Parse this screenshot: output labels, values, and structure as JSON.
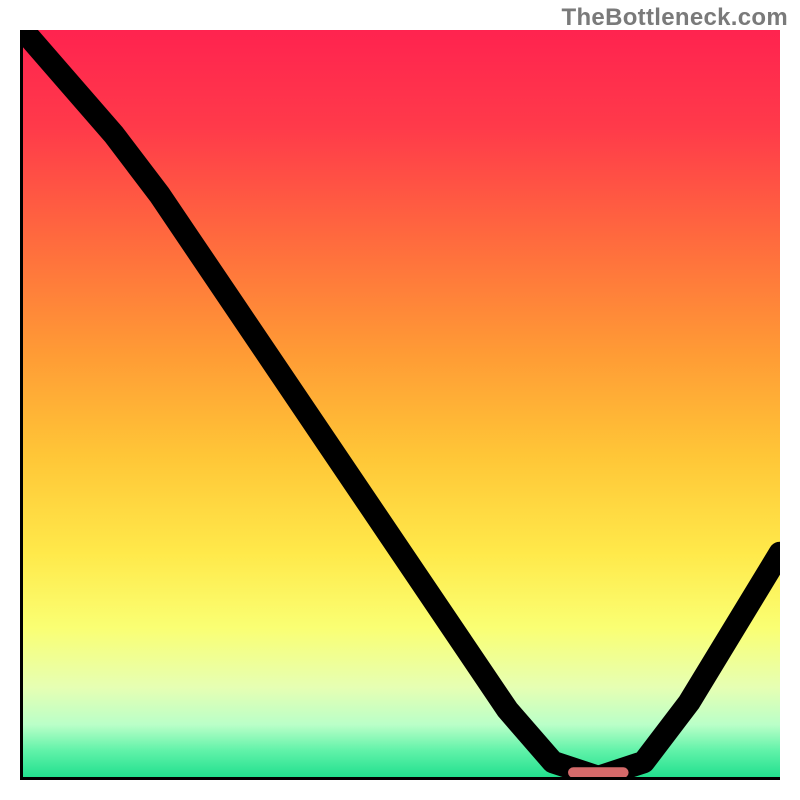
{
  "watermark": {
    "text": "TheBottleneck.com"
  },
  "colors": {
    "axis": "#000000",
    "line": "#000000",
    "marker": "#d46a6a",
    "gradient_stops": [
      {
        "offset": 0.0,
        "color": "#ff234f"
      },
      {
        "offset": 0.13,
        "color": "#ff3a4a"
      },
      {
        "offset": 0.28,
        "color": "#ff6a3e"
      },
      {
        "offset": 0.43,
        "color": "#ff9a35"
      },
      {
        "offset": 0.57,
        "color": "#ffc637"
      },
      {
        "offset": 0.7,
        "color": "#ffe94a"
      },
      {
        "offset": 0.8,
        "color": "#faff73"
      },
      {
        "offset": 0.88,
        "color": "#e6ffb3"
      },
      {
        "offset": 0.93,
        "color": "#baffc8"
      },
      {
        "offset": 0.965,
        "color": "#60f2a9"
      },
      {
        "offset": 1.0,
        "color": "#22e08e"
      }
    ]
  },
  "chart_data": {
    "type": "line",
    "title": "",
    "xlabel": "",
    "ylabel": "",
    "xlim": [
      0,
      100
    ],
    "ylim": [
      0,
      100
    ],
    "grid": false,
    "series": [
      {
        "name": "curve",
        "x": [
          0,
          6,
          12,
          18,
          22,
          28,
          34,
          40,
          46,
          52,
          58,
          64,
          70,
          76,
          82,
          88,
          100
        ],
        "y": [
          100,
          93,
          86,
          78,
          72,
          63,
          54,
          45,
          36,
          27,
          18,
          9,
          2,
          0,
          2,
          10,
          30
        ]
      }
    ],
    "annotations": [
      {
        "name": "optimum-marker",
        "x0": 72,
        "x1": 80,
        "y": 0.6
      }
    ]
  }
}
